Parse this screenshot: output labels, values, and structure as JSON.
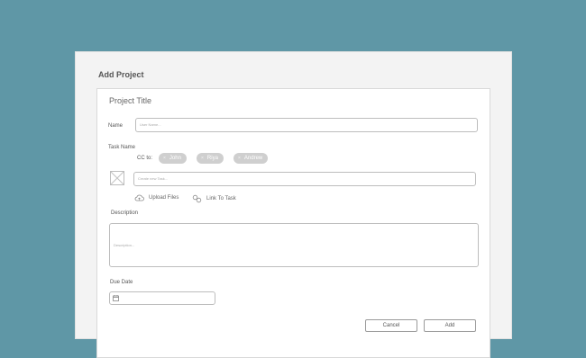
{
  "dialog": {
    "title": "Add Project",
    "project_title": "Project Title"
  },
  "form": {
    "name_label": "Name",
    "name_placeholder": "User Name...",
    "task_label": "Task Name",
    "cc_label": "CC to:",
    "cc_recipients": [
      "John",
      "Riya",
      "Andrew"
    ],
    "task_placeholder": "Create new Task...",
    "upload_label": "Upload Files",
    "link_label": "Link To Task",
    "description_label": "Description",
    "description_placeholder": "Description...",
    "due_date_label": "Due Date"
  },
  "footer": {
    "cancel_label": "Cancel",
    "add_label": "Add"
  }
}
